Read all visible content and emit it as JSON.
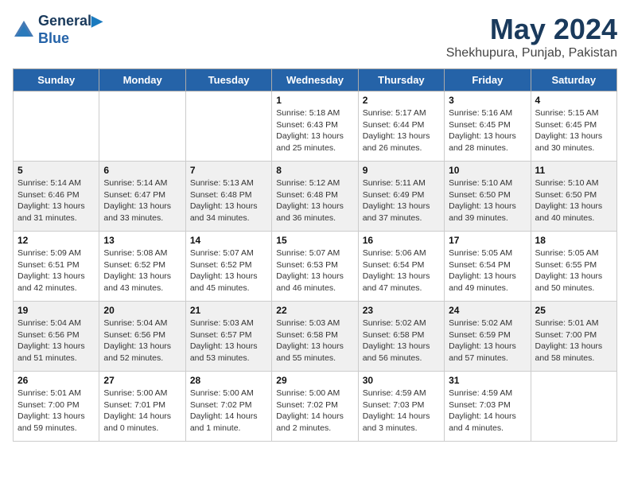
{
  "header": {
    "logo_line1": "General",
    "logo_line2": "Blue",
    "month": "May 2024",
    "location": "Shekhupura, Punjab, Pakistan"
  },
  "columns": [
    "Sunday",
    "Monday",
    "Tuesday",
    "Wednesday",
    "Thursday",
    "Friday",
    "Saturday"
  ],
  "weeks": [
    [
      {
        "day": "",
        "detail": ""
      },
      {
        "day": "",
        "detail": ""
      },
      {
        "day": "",
        "detail": ""
      },
      {
        "day": "1",
        "detail": "Sunrise: 5:18 AM\nSunset: 6:43 PM\nDaylight: 13 hours\nand 25 minutes."
      },
      {
        "day": "2",
        "detail": "Sunrise: 5:17 AM\nSunset: 6:44 PM\nDaylight: 13 hours\nand 26 minutes."
      },
      {
        "day": "3",
        "detail": "Sunrise: 5:16 AM\nSunset: 6:45 PM\nDaylight: 13 hours\nand 28 minutes."
      },
      {
        "day": "4",
        "detail": "Sunrise: 5:15 AM\nSunset: 6:45 PM\nDaylight: 13 hours\nand 30 minutes."
      }
    ],
    [
      {
        "day": "5",
        "detail": "Sunrise: 5:14 AM\nSunset: 6:46 PM\nDaylight: 13 hours\nand 31 minutes."
      },
      {
        "day": "6",
        "detail": "Sunrise: 5:14 AM\nSunset: 6:47 PM\nDaylight: 13 hours\nand 33 minutes."
      },
      {
        "day": "7",
        "detail": "Sunrise: 5:13 AM\nSunset: 6:48 PM\nDaylight: 13 hours\nand 34 minutes."
      },
      {
        "day": "8",
        "detail": "Sunrise: 5:12 AM\nSunset: 6:48 PM\nDaylight: 13 hours\nand 36 minutes."
      },
      {
        "day": "9",
        "detail": "Sunrise: 5:11 AM\nSunset: 6:49 PM\nDaylight: 13 hours\nand 37 minutes."
      },
      {
        "day": "10",
        "detail": "Sunrise: 5:10 AM\nSunset: 6:50 PM\nDaylight: 13 hours\nand 39 minutes."
      },
      {
        "day": "11",
        "detail": "Sunrise: 5:10 AM\nSunset: 6:50 PM\nDaylight: 13 hours\nand 40 minutes."
      }
    ],
    [
      {
        "day": "12",
        "detail": "Sunrise: 5:09 AM\nSunset: 6:51 PM\nDaylight: 13 hours\nand 42 minutes."
      },
      {
        "day": "13",
        "detail": "Sunrise: 5:08 AM\nSunset: 6:52 PM\nDaylight: 13 hours\nand 43 minutes."
      },
      {
        "day": "14",
        "detail": "Sunrise: 5:07 AM\nSunset: 6:52 PM\nDaylight: 13 hours\nand 45 minutes."
      },
      {
        "day": "15",
        "detail": "Sunrise: 5:07 AM\nSunset: 6:53 PM\nDaylight: 13 hours\nand 46 minutes."
      },
      {
        "day": "16",
        "detail": "Sunrise: 5:06 AM\nSunset: 6:54 PM\nDaylight: 13 hours\nand 47 minutes."
      },
      {
        "day": "17",
        "detail": "Sunrise: 5:05 AM\nSunset: 6:54 PM\nDaylight: 13 hours\nand 49 minutes."
      },
      {
        "day": "18",
        "detail": "Sunrise: 5:05 AM\nSunset: 6:55 PM\nDaylight: 13 hours\nand 50 minutes."
      }
    ],
    [
      {
        "day": "19",
        "detail": "Sunrise: 5:04 AM\nSunset: 6:56 PM\nDaylight: 13 hours\nand 51 minutes."
      },
      {
        "day": "20",
        "detail": "Sunrise: 5:04 AM\nSunset: 6:56 PM\nDaylight: 13 hours\nand 52 minutes."
      },
      {
        "day": "21",
        "detail": "Sunrise: 5:03 AM\nSunset: 6:57 PM\nDaylight: 13 hours\nand 53 minutes."
      },
      {
        "day": "22",
        "detail": "Sunrise: 5:03 AM\nSunset: 6:58 PM\nDaylight: 13 hours\nand 55 minutes."
      },
      {
        "day": "23",
        "detail": "Sunrise: 5:02 AM\nSunset: 6:58 PM\nDaylight: 13 hours\nand 56 minutes."
      },
      {
        "day": "24",
        "detail": "Sunrise: 5:02 AM\nSunset: 6:59 PM\nDaylight: 13 hours\nand 57 minutes."
      },
      {
        "day": "25",
        "detail": "Sunrise: 5:01 AM\nSunset: 7:00 PM\nDaylight: 13 hours\nand 58 minutes."
      }
    ],
    [
      {
        "day": "26",
        "detail": "Sunrise: 5:01 AM\nSunset: 7:00 PM\nDaylight: 13 hours\nand 59 minutes."
      },
      {
        "day": "27",
        "detail": "Sunrise: 5:00 AM\nSunset: 7:01 PM\nDaylight: 14 hours\nand 0 minutes."
      },
      {
        "day": "28",
        "detail": "Sunrise: 5:00 AM\nSunset: 7:02 PM\nDaylight: 14 hours\nand 1 minute."
      },
      {
        "day": "29",
        "detail": "Sunrise: 5:00 AM\nSunset: 7:02 PM\nDaylight: 14 hours\nand 2 minutes."
      },
      {
        "day": "30",
        "detail": "Sunrise: 4:59 AM\nSunset: 7:03 PM\nDaylight: 14 hours\nand 3 minutes."
      },
      {
        "day": "31",
        "detail": "Sunrise: 4:59 AM\nSunset: 7:03 PM\nDaylight: 14 hours\nand 4 minutes."
      },
      {
        "day": "",
        "detail": ""
      }
    ]
  ]
}
